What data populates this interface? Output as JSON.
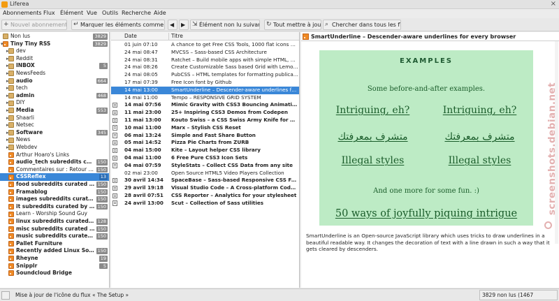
{
  "window": {
    "title": "Liferea",
    "close_glyph": "×"
  },
  "menu": [
    "Abonnements",
    "Flux",
    "Élément",
    "Vue",
    "Outils",
    "Recherche",
    "Aide"
  ],
  "toolbar": {
    "new_subscription": "Nouvel abonnement...",
    "mark_all_read": "Marquer les éléments comme lus",
    "next_unread": "Élément non lu suivant",
    "update_all": "Tout mettre à jour",
    "search_all": "Chercher dans tous les flux ..."
  },
  "feeds": [
    {
      "name": "Non lus",
      "count": "3829",
      "icon": "folder-icon",
      "bold": false,
      "arrow": "",
      "indent": 0
    },
    {
      "name": "Tiny Tiny RSS",
      "count": "3829",
      "icon": "rss-icon",
      "bold": true,
      "arrow": "▾",
      "indent": 0
    },
    {
      "name": "dev",
      "count": "",
      "icon": "folder-icon",
      "bold": false,
      "arrow": "▸",
      "indent": 1
    },
    {
      "name": "Reddit",
      "count": "",
      "icon": "folder-icon",
      "bold": false,
      "arrow": "▸",
      "indent": 1
    },
    {
      "name": "INBOX",
      "count": "5",
      "icon": "folder-icon",
      "bold": true,
      "arrow": "▸",
      "indent": 1
    },
    {
      "name": "NewsFeeds",
      "count": "",
      "icon": "folder-icon",
      "bold": false,
      "arrow": "▸",
      "indent": 1
    },
    {
      "name": "audio",
      "count": "664",
      "icon": "folder-icon",
      "bold": true,
      "arrow": "▸",
      "indent": 1
    },
    {
      "name": "tech",
      "count": "",
      "icon": "folder-icon",
      "bold": false,
      "arrow": "▸",
      "indent": 1
    },
    {
      "name": "admin",
      "count": "468",
      "icon": "folder-icon",
      "bold": true,
      "arrow": "▸",
      "indent": 1
    },
    {
      "name": "DIY",
      "count": "",
      "icon": "folder-icon",
      "bold": false,
      "arrow": "▸",
      "indent": 1
    },
    {
      "name": "Media",
      "count": "553",
      "icon": "folder-icon",
      "bold": true,
      "arrow": "▸",
      "indent": 1
    },
    {
      "name": "Shaarli",
      "count": "",
      "icon": "folder-icon",
      "bold": false,
      "arrow": "▸",
      "indent": 1
    },
    {
      "name": "Netsec",
      "count": "",
      "icon": "folder-icon",
      "bold": false,
      "arrow": "▸",
      "indent": 1
    },
    {
      "name": "Software",
      "count": "345",
      "icon": "folder-icon",
      "bold": true,
      "arrow": "▸",
      "indent": 1
    },
    {
      "name": "News",
      "count": "",
      "icon": "folder-icon",
      "bold": false,
      "arrow": "▸",
      "indent": 1
    },
    {
      "name": "Webdev",
      "count": "",
      "icon": "folder-icon",
      "bold": false,
      "arrow": "▸",
      "indent": 1
    },
    {
      "name": "Arthur Hoaro's Links",
      "count": "",
      "icon": "rss-icon",
      "bold": false,
      "arrow": "",
      "indent": 1
    },
    {
      "name": "audio_tech subreddits curated by...",
      "count": "150",
      "icon": "rss-icon",
      "bold": true,
      "arrow": "",
      "indent": 1
    },
    {
      "name": "Commentaires sur : Retour s...",
      "count": "150",
      "icon": "rss-icon",
      "bold": false,
      "arrow": "",
      "indent": 1
    },
    {
      "name": "CSSReflex",
      "count": "13",
      "icon": "rss-icon",
      "bold": true,
      "arrow": "",
      "indent": 1,
      "selected": true
    },
    {
      "name": "food subreddits curated by...",
      "count": "150",
      "icon": "rss-icon",
      "bold": true,
      "arrow": "",
      "indent": 1
    },
    {
      "name": "Framablog",
      "count": "150",
      "icon": "rss-icon",
      "bold": true,
      "arrow": "",
      "indent": 1
    },
    {
      "name": "images subreddits curated by...",
      "count": "150",
      "icon": "rss-icon",
      "bold": true,
      "arrow": "",
      "indent": 1
    },
    {
      "name": "it subreddits curated by /u/...",
      "count": "150",
      "icon": "rss-icon",
      "bold": true,
      "arrow": "",
      "indent": 1
    },
    {
      "name": "Learn - Worship Sound Guy",
      "count": "",
      "icon": "rss-icon",
      "bold": false,
      "arrow": "",
      "indent": 1
    },
    {
      "name": "linux subreddits curated by...",
      "count": "128",
      "icon": "rss-icon",
      "bold": true,
      "arrow": "",
      "indent": 1
    },
    {
      "name": "misc subreddits curated b...",
      "count": "150",
      "icon": "rss-icon",
      "bold": true,
      "arrow": "",
      "indent": 1
    },
    {
      "name": "music subreddits curated by...",
      "count": "150",
      "icon": "rss-icon",
      "bold": true,
      "arrow": "",
      "indent": 1
    },
    {
      "name": "Pallet Furniture",
      "count": "",
      "icon": "rss-icon",
      "bold": true,
      "arrow": "",
      "indent": 1
    },
    {
      "name": "Recently added Linux Soft...",
      "count": "150",
      "icon": "rss-icon",
      "bold": true,
      "arrow": "",
      "indent": 1
    },
    {
      "name": "Rheyne",
      "count": "19",
      "icon": "rss-icon",
      "bold": true,
      "arrow": "",
      "indent": 1
    },
    {
      "name": "Snipplr",
      "count": "5",
      "icon": "rss-icon",
      "bold": true,
      "arrow": "",
      "indent": 1
    },
    {
      "name": "Soundcloud Bridge",
      "count": "",
      "icon": "rss-icon",
      "bold": true,
      "arrow": "",
      "indent": 1
    }
  ],
  "items_header": {
    "date": "Date",
    "title": "Titre"
  },
  "items": [
    {
      "date": "01 juin 07:10",
      "title": "A chance to get Free CSS Tools, 1000 flat icons and ...",
      "unread": false
    },
    {
      "date": "24 mai 08:47",
      "title": "MVCSS – Sass-based CSS Architecture",
      "unread": false
    },
    {
      "date": "24 mai 08:31",
      "title": "Ratchet – Build mobile apps with simple HTML, CSS,...",
      "unread": false
    },
    {
      "date": "24 mai 08:26",
      "title": "Create Customizable Sass based Grid with Lemona...",
      "unread": false
    },
    {
      "date": "24 mai 08:05",
      "title": "PubCSS – HTML templates for formatting publicatio...",
      "unread": false
    },
    {
      "date": "17 mai 07:39",
      "title": "Free Icon font by Github",
      "unread": false
    },
    {
      "date": "14 mai 13:00",
      "title": "SmartUnderline – Descender-aware underlines for ...",
      "unread": false,
      "selected": true
    },
    {
      "date": "14 mai 11:00",
      "title": "Tempo – RESPONSIVE GRID SYSTEM",
      "unread": false
    },
    {
      "date": "14 mai 07:56",
      "title": "Mimic Gravity with CSS3 Bouncing Animation",
      "unread": true
    },
    {
      "date": "11 mai 23:00",
      "title": "25+ Inspiring CSS3 Demos from Codepen",
      "unread": true
    },
    {
      "date": "11 mai 13:00",
      "title": "Kouto Swiss – a CSS Swiss Army Knife for Stylus",
      "unread": true
    },
    {
      "date": "10 mai 11:00",
      "title": "Marx – Stylish CSS Reset",
      "unread": true
    },
    {
      "date": "06 mai 13:24",
      "title": "Simple and Fast Share Button",
      "unread": true
    },
    {
      "date": "05 mai 14:52",
      "title": "Pizza Pie Charts from ZURB",
      "unread": true
    },
    {
      "date": "04 mai 15:00",
      "title": "Kite – Layout helper CSS library",
      "unread": true
    },
    {
      "date": "04 mai 11:00",
      "title": "6 Free Pure CSS3 Icon Sets",
      "unread": true
    },
    {
      "date": "04 mai 07:59",
      "title": "StyleStats – Collect CSS Data from any site",
      "unread": true
    },
    {
      "date": "02 mai 23:00",
      "title": "Open Source HTML5 Video Players Collection",
      "unread": false
    },
    {
      "date": "30 avril 14:34",
      "title": "SpaceBase – Sass-based Responsive CSS Framew...",
      "unread": true
    },
    {
      "date": "29 avril 19:18",
      "title": "Visual Studio Code – A Cross-platform Code Edit...",
      "unread": true
    },
    {
      "date": "28 avril 07:51",
      "title": "CSS Reporter – Analytics for your stylesheet",
      "unread": true
    },
    {
      "date": "24 avril 13:00",
      "title": "Scut – Collection of Sass utilities",
      "unread": true
    }
  ],
  "reader": {
    "title": "SmartUnderline – Descender-aware underlines for every browser",
    "examples_heading": "EXAMPLES",
    "intro": "Some before-and-after examples.",
    "pairs": [
      [
        "Intriguing, eh?",
        "Intriguing, eh?"
      ],
      [
        "متشرف بمعرفتك",
        "متشرف بمعرفتك"
      ],
      [
        "Illegal styles",
        "Illegal styles"
      ]
    ],
    "more": "And one more for some fun. :)",
    "final": "50 ways of joyfully piquing intrigue",
    "description": "SmartUnderline is an Open-source JavaScript library which uses tricks to draw underlines in a beautiful readable way. It changes the decoration of text with a line drawn in such a way that it gets cleared by descenders."
  },
  "watermark": "screenshots.debian.net",
  "status": {
    "left": "Mise à jour de l'icône du flux « The Setup »",
    "right": "3829 non lus (1467 nouveaux)"
  },
  "colors": {
    "selection": "#3a87d8",
    "examples_bg": "#bdebc5",
    "examples_text": "#1a5c2a",
    "rss": "#f08a24"
  }
}
